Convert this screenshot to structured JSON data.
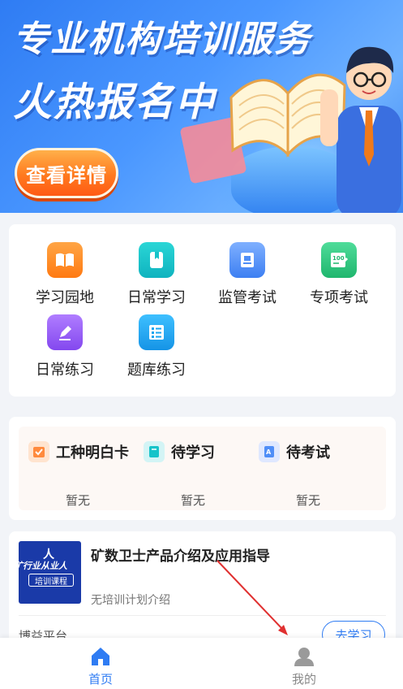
{
  "banner": {
    "title_line1": "专业机构培训服务",
    "title_line2": "火热报名中",
    "cta_label": "查看详情"
  },
  "menu": {
    "items": [
      {
        "label": "学习园地",
        "icon": "book-open-icon",
        "color": "#ff8a1f"
      },
      {
        "label": "日常学习",
        "icon": "bookmark-book-icon",
        "color": "#16c3c9"
      },
      {
        "label": "监管考试",
        "icon": "scroll-certificate-icon",
        "color": "#4f8ef7"
      },
      {
        "label": "专项考试",
        "icon": "score-pen-icon",
        "color": "#2fc882"
      },
      {
        "label": "日常练习",
        "icon": "pen-edit-icon",
        "color": "#9a5cf5"
      },
      {
        "label": "题库练习",
        "icon": "list-document-icon",
        "color": "#1aa6f0"
      }
    ]
  },
  "status": {
    "items": [
      {
        "label": "工种明白卡",
        "value": "暂无",
        "icon": "checklist-icon",
        "color": "#ff8a3d"
      },
      {
        "label": "待学习",
        "value": "暂无",
        "icon": "book-icon",
        "color": "#16c3c9"
      },
      {
        "label": "待考试",
        "value": "暂无",
        "icon": "exam-paper-icon",
        "color": "#4f8ef7"
      }
    ]
  },
  "course": {
    "thumb_logo": "人",
    "thumb_line1": "矿行业从业人",
    "thumb_line2": "培训课程",
    "title": "矿数卫士产品介绍及应用指导",
    "desc": "无培训计划介绍",
    "org": "博益平台",
    "button_label": "去学习"
  },
  "tabbar": {
    "items": [
      {
        "label": "首页",
        "icon": "home-icon",
        "active": true
      },
      {
        "label": "我的",
        "icon": "user-icon",
        "active": false
      }
    ],
    "active_color": "#2f7cf3",
    "inactive_color": "#888888"
  }
}
